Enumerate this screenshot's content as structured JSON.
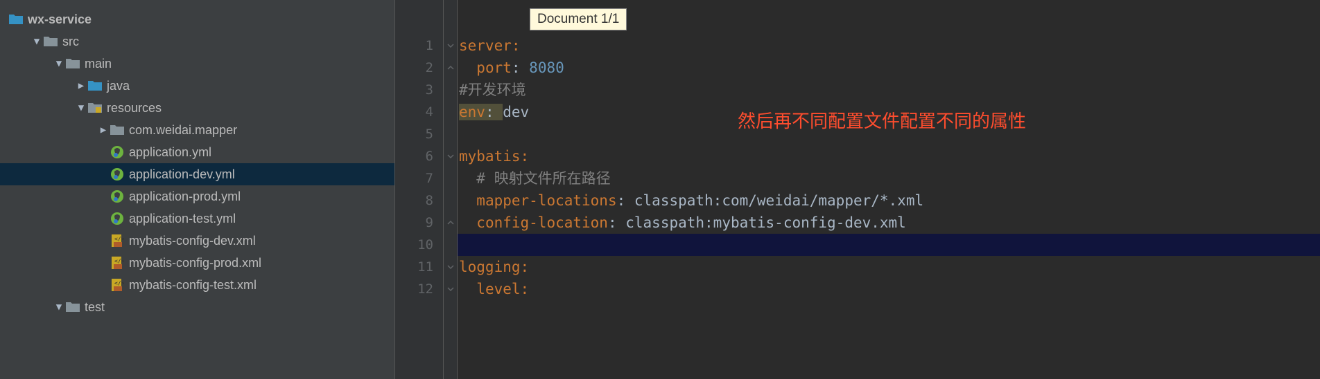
{
  "tree": {
    "root": {
      "label": "wx-service",
      "indent": 0,
      "arrow": "",
      "icon": "folder-teal"
    },
    "items": [
      {
        "label": "src",
        "indent": 1,
        "arrow": "▼",
        "icon": "folder"
      },
      {
        "label": "main",
        "indent": 2,
        "arrow": "▼",
        "icon": "folder"
      },
      {
        "label": "java",
        "indent": 3,
        "arrow": "▶",
        "icon": "folder-teal"
      },
      {
        "label": "resources",
        "indent": 3,
        "arrow": "▼",
        "icon": "resources"
      },
      {
        "label": "com.weidai.mapper",
        "indent": 4,
        "arrow": "▶",
        "icon": "folder"
      },
      {
        "label": "application.yml",
        "indent": 4,
        "arrow": "",
        "icon": "spring"
      },
      {
        "label": "application-dev.yml",
        "indent": 4,
        "arrow": "",
        "icon": "spring",
        "selected": true
      },
      {
        "label": "application-prod.yml",
        "indent": 4,
        "arrow": "",
        "icon": "spring"
      },
      {
        "label": "application-test.yml",
        "indent": 4,
        "arrow": "",
        "icon": "spring"
      },
      {
        "label": "mybatis-config-dev.xml",
        "indent": 4,
        "arrow": "",
        "icon": "xml"
      },
      {
        "label": "mybatis-config-prod.xml",
        "indent": 4,
        "arrow": "",
        "icon": "xml"
      },
      {
        "label": "mybatis-config-test.xml",
        "indent": 4,
        "arrow": "",
        "icon": "xml"
      },
      {
        "label": "test",
        "indent": 2,
        "arrow": "▼",
        "icon": "folder"
      }
    ]
  },
  "editor": {
    "doc_indicator": "Document 1/1",
    "annotation": "然后再不同配置文件配置不同的属性",
    "lines": [
      {
        "n": 1,
        "fold": "▾",
        "tokens": [
          {
            "t": "server",
            "c": "key"
          },
          {
            "t": ":",
            "c": "key"
          }
        ]
      },
      {
        "n": 2,
        "fold": "▴",
        "tokens": [
          {
            "t": "  ",
            "c": ""
          },
          {
            "t": "port",
            "c": "key"
          },
          {
            "t": ": ",
            "c": ""
          },
          {
            "t": "8080",
            "c": "num"
          }
        ]
      },
      {
        "n": 3,
        "fold": "",
        "tokens": [
          {
            "t": "#开发环境",
            "c": "comment"
          }
        ]
      },
      {
        "n": 4,
        "fold": "",
        "tokens": [
          {
            "t": "env",
            "c": "key warn"
          },
          {
            "t": ": ",
            "c": "warn"
          },
          {
            "t": "dev",
            "c": "val"
          }
        ]
      },
      {
        "n": 5,
        "fold": "",
        "tokens": []
      },
      {
        "n": 6,
        "fold": "▾",
        "tokens": [
          {
            "t": "mybatis",
            "c": "key"
          },
          {
            "t": ":",
            "c": "key"
          }
        ]
      },
      {
        "n": 7,
        "fold": "",
        "tokens": [
          {
            "t": "  ",
            "c": ""
          },
          {
            "t": "# 映射文件所在路径",
            "c": "comment"
          }
        ]
      },
      {
        "n": 8,
        "fold": "",
        "tokens": [
          {
            "t": "  ",
            "c": ""
          },
          {
            "t": "mapper-locations",
            "c": "key"
          },
          {
            "t": ": ",
            "c": ""
          },
          {
            "t": "classpath:com/weidai/mapper/*.xml",
            "c": "val"
          }
        ]
      },
      {
        "n": 9,
        "fold": "▴",
        "tokens": [
          {
            "t": "  ",
            "c": ""
          },
          {
            "t": "config-location",
            "c": "key"
          },
          {
            "t": ": ",
            "c": ""
          },
          {
            "t": "classpath:mybatis-config-dev.xml",
            "c": "val"
          }
        ]
      },
      {
        "n": 10,
        "fold": "",
        "tokens": [],
        "highlighted": true
      },
      {
        "n": 11,
        "fold": "▾",
        "tokens": [
          {
            "t": "logging",
            "c": "key"
          },
          {
            "t": ":",
            "c": "key"
          }
        ]
      },
      {
        "n": 12,
        "fold": "▾",
        "tokens": [
          {
            "t": "  ",
            "c": ""
          },
          {
            "t": "level",
            "c": "key"
          },
          {
            "t": ":",
            "c": "key"
          }
        ]
      }
    ]
  }
}
